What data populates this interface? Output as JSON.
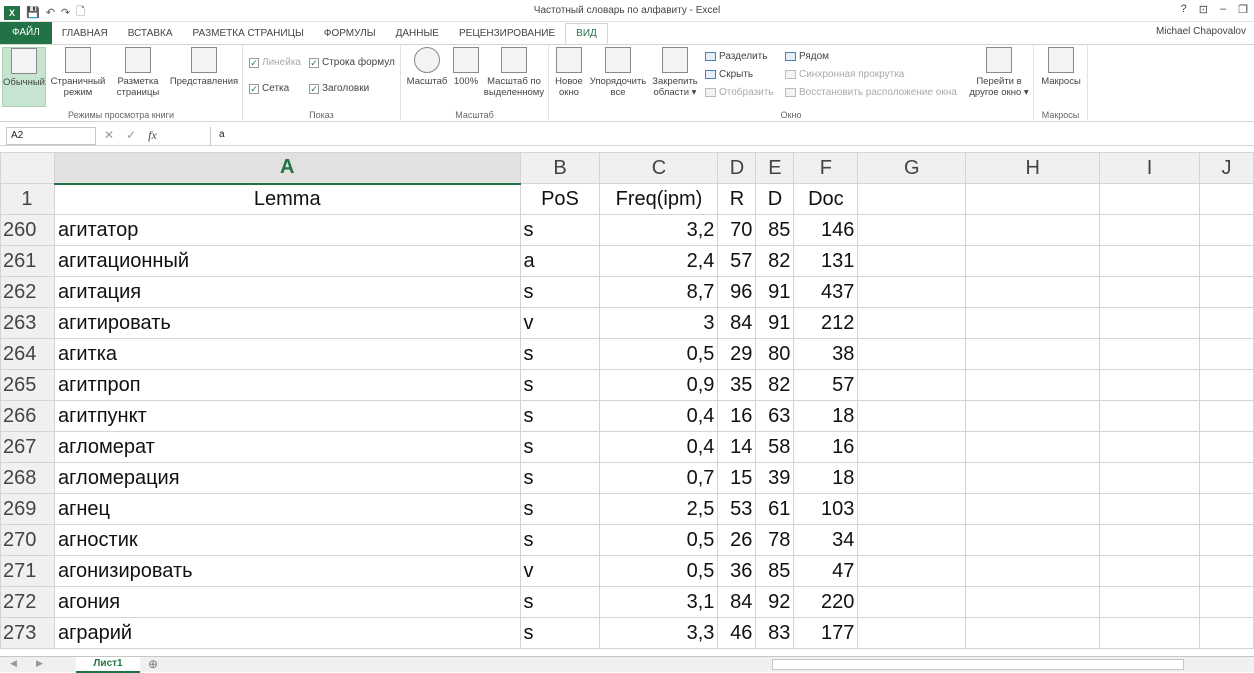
{
  "window": {
    "title": "Частотный словарь по алфавиту - Excel",
    "user": "Michael Chapovalov",
    "controls": [
      "?",
      "⊡",
      "–",
      "❐"
    ]
  },
  "qat": {
    "logo": "X",
    "save": "💾",
    "undo": "↶",
    "redo": "↷",
    "preview": "🗋"
  },
  "tabs": [
    {
      "label": "ФАЙЛ"
    },
    {
      "label": "ГЛАВНАЯ"
    },
    {
      "label": "ВСТАВКА"
    },
    {
      "label": "РАЗМЕТКА СТРАНИЦЫ"
    },
    {
      "label": "ФОРМУЛЫ"
    },
    {
      "label": "ДАННЫЕ"
    },
    {
      "label": "РЕЦЕНЗИРОВАНИЕ"
    },
    {
      "label": "ВИД"
    }
  ],
  "ribbon": {
    "views": {
      "group_label": "Режимы просмотра книги",
      "normal": "Обычный",
      "page_mode_1": "Страничный",
      "page_mode_2": "режим",
      "page_layout_1": "Разметка",
      "page_layout_2": "страницы",
      "custom_views": "Представления"
    },
    "show": {
      "group_label": "Показ",
      "ruler": "Линейка",
      "formula_bar": "Строка формул",
      "grid": "Сетка",
      "headings": "Заголовки"
    },
    "zoom": {
      "group_label": "Масштаб",
      "zoom": "Масштаб",
      "hundred": "100%",
      "zoom_sel_1": "Масштаб по",
      "zoom_sel_2": "выделенному"
    },
    "window": {
      "group_label": "Окно",
      "new_1": "Новое",
      "new_2": "окно",
      "arrange_1": "Упорядочить",
      "arrange_2": "все",
      "freeze_1": "Закрепить",
      "freeze_2": "области ▾",
      "split": "Разделить",
      "hide": "Скрыть",
      "unhide": "Отобразить",
      "side_by_side": "Рядом",
      "sync_scroll": "Синхронная прокрутка",
      "reset_pos": "Восстановить расположение окна",
      "switch_1": "Перейти в",
      "switch_2": "другое окно ▾"
    },
    "macros": {
      "group_label": "Макросы",
      "macros": "Макросы"
    }
  },
  "formula_bar": {
    "name_box": "A2",
    "content": "a",
    "fx": "fx",
    "cancel": "✕",
    "enter": "✓"
  },
  "columns": [
    "A",
    "B",
    "C",
    "D",
    "E",
    "F",
    "G",
    "H",
    "I",
    "J"
  ],
  "header_row": {
    "row": "1",
    "A": "Lemma",
    "B": "PoS",
    "C": "Freq(ipm)",
    "D": "R",
    "E": "D",
    "F": "Doc"
  },
  "rows": [
    {
      "row": "260",
      "lemma": "агитатор",
      "pos": "s",
      "freq": "3,2",
      "r": "70",
      "d": "85",
      "doc": "146"
    },
    {
      "row": "261",
      "lemma": "агитационный",
      "pos": "a",
      "freq": "2,4",
      "r": "57",
      "d": "82",
      "doc": "131"
    },
    {
      "row": "262",
      "lemma": "агитация",
      "pos": "s",
      "freq": "8,7",
      "r": "96",
      "d": "91",
      "doc": "437"
    },
    {
      "row": "263",
      "lemma": "агитировать",
      "pos": "v",
      "freq": "3",
      "r": "84",
      "d": "91",
      "doc": "212"
    },
    {
      "row": "264",
      "lemma": "агитка",
      "pos": "s",
      "freq": "0,5",
      "r": "29",
      "d": "80",
      "doc": "38"
    },
    {
      "row": "265",
      "lemma": "агитпроп",
      "pos": "s",
      "freq": "0,9",
      "r": "35",
      "d": "82",
      "doc": "57"
    },
    {
      "row": "266",
      "lemma": "агитпункт",
      "pos": "s",
      "freq": "0,4",
      "r": "16",
      "d": "63",
      "doc": "18"
    },
    {
      "row": "267",
      "lemma": "агломерат",
      "pos": "s",
      "freq": "0,4",
      "r": "14",
      "d": "58",
      "doc": "16"
    },
    {
      "row": "268",
      "lemma": "агломерация",
      "pos": "s",
      "freq": "0,7",
      "r": "15",
      "d": "39",
      "doc": "18"
    },
    {
      "row": "269",
      "lemma": "агнец",
      "pos": "s",
      "freq": "2,5",
      "r": "53",
      "d": "61",
      "doc": "103"
    },
    {
      "row": "270",
      "lemma": "агностик",
      "pos": "s",
      "freq": "0,5",
      "r": "26",
      "d": "78",
      "doc": "34"
    },
    {
      "row": "271",
      "lemma": "агонизировать",
      "pos": "v",
      "freq": "0,5",
      "r": "36",
      "d": "85",
      "doc": "47"
    },
    {
      "row": "272",
      "lemma": "агония",
      "pos": "s",
      "freq": "3,1",
      "r": "84",
      "d": "92",
      "doc": "220"
    },
    {
      "row": "273",
      "lemma": "аграрий",
      "pos": "s",
      "freq": "3,3",
      "r": "46",
      "d": "83",
      "doc": "177"
    }
  ],
  "sheets": {
    "active": "Лист1",
    "add": "⊕"
  },
  "colors": {
    "accent": "#217346"
  }
}
